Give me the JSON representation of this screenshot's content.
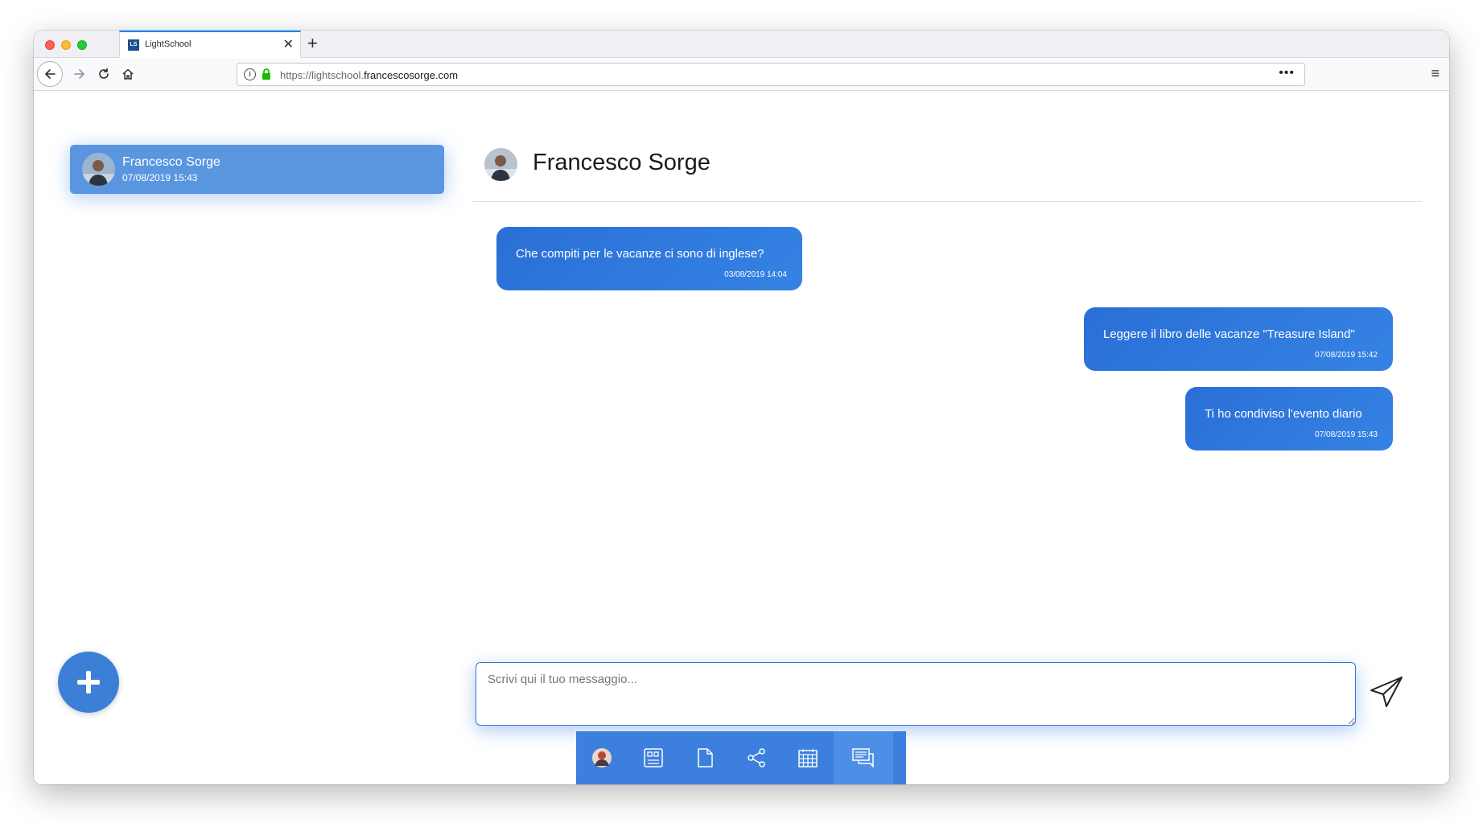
{
  "browser": {
    "tab_title": "LightSchool",
    "favicon_text": "LS",
    "tab_close": "✕",
    "new_tab": "+",
    "url_prefix": "https://lightschool.",
    "url_host": "francescosorge.com",
    "url_more": "•••",
    "menu": "≡"
  },
  "sidebar": {
    "conversations": [
      {
        "name": "Francesco Sorge",
        "time": "07/08/2019 15:43"
      }
    ]
  },
  "chat": {
    "contact_name": "Francesco Sorge",
    "messages": [
      {
        "text": "Che compiti per le vacanze ci sono di inglese?",
        "time": "03/08/2019 14:04",
        "side": "left"
      },
      {
        "text": "Leggere il libro delle vacanze \"Treasure Island\"",
        "time": "07/08/2019 15:42",
        "side": "right"
      },
      {
        "text": "Ti ho condiviso l'evento diario",
        "time": "07/08/2019 15:43",
        "side": "right"
      }
    ],
    "input_placeholder": "Scrivi qui il tuo messaggio..."
  },
  "bottom_nav": {
    "items": [
      "avatar-icon",
      "dashboard-icon",
      "file-icon",
      "share-icon",
      "calendar-icon",
      "chat-icon"
    ],
    "active": "chat-icon"
  },
  "colors": {
    "accent": "#3d7fdc",
    "bubble": "#2e7ae0",
    "conversation_item": "#5a96e0"
  }
}
